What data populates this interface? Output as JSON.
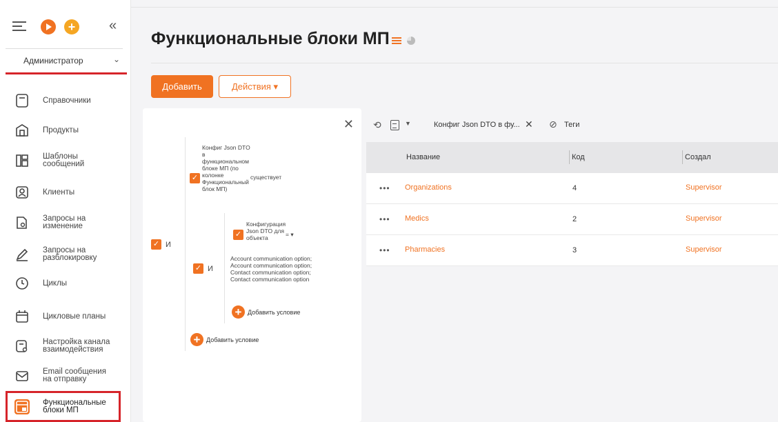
{
  "sidebar": {
    "role": "Администратор",
    "items": [
      {
        "label": "Справочники",
        "icon": "book-icon"
      },
      {
        "label": "Продукты",
        "icon": "box-icon"
      },
      {
        "label": "Шаблоны\nсообщений",
        "icon": "template-icon"
      },
      {
        "label": "Клиенты",
        "icon": "person-icon"
      },
      {
        "label": "Запросы на\nизменение",
        "icon": "doc-search-icon"
      },
      {
        "label": "Запросы на\nразблокировку",
        "icon": "pencil-icon"
      },
      {
        "label": "Циклы",
        "icon": "clock-icon"
      },
      {
        "label": "Цикловые планы",
        "icon": "calendar-icon"
      },
      {
        "label": "Настройка канала\nвзаимодействия",
        "icon": "channel-settings-icon"
      },
      {
        "label": "Email сообщения\nна отправку",
        "icon": "envelope-icon"
      },
      {
        "label": "Функциональные\nблоки МП",
        "icon": "blocks-icon",
        "active": true
      }
    ]
  },
  "page": {
    "title": "Функциональные блоки МП",
    "add_label": "Добавить",
    "actions_label": "Действия ▾"
  },
  "filter": {
    "root_and": "И",
    "cond1": "Конфиг Json DTO\nв\nфункциональном\nблоке МП (по\nколонке\nФункциональный\nблок МП)",
    "cond1_op": "существует",
    "inner_and": "И",
    "cond2": "Конфигурация\nJson DTO для\nобъекта",
    "cond2_op": "= ▾",
    "cond2_value": "Account communication option;\nAccount communication option;\nContact communication option;\nContact communication option",
    "add_condition_inner": "Добавить условие",
    "add_condition_outer": "Добавить условие"
  },
  "toolbar": {
    "active_filter": "Конфиг Json DTO в фу...",
    "tags_label": "Теги"
  },
  "table": {
    "columns": [
      "Название",
      "Код",
      "Создал"
    ],
    "rows": [
      {
        "name": "Organizations",
        "code": "4",
        "creator": "Supervisor"
      },
      {
        "name": "Medics",
        "code": "2",
        "creator": "Supervisor"
      },
      {
        "name": "Pharmacies",
        "code": "3",
        "creator": "Supervisor"
      }
    ]
  },
  "colors": {
    "accent": "#f07222",
    "highlight": "#d6242a"
  }
}
